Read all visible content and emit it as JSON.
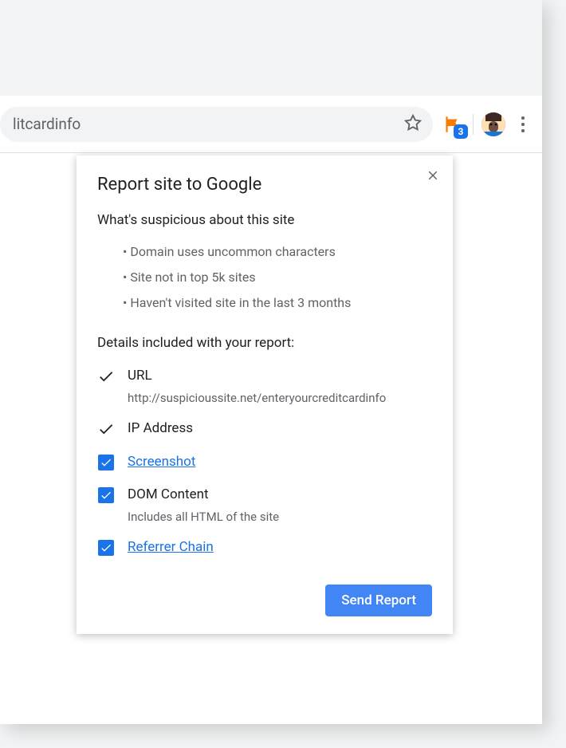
{
  "toolbar": {
    "omnibox_text": "litcardinfo",
    "flag_badge": "3"
  },
  "popup": {
    "title": "Report site to Google",
    "suspicious_heading": "What's suspicious about this site",
    "bullets": [
      "• Domain uses uncommon characters",
      "• Site not in top 5k sites",
      "• Haven't visited site in the last 3 months"
    ],
    "details_heading": "Details included with your report:",
    "items": {
      "url": {
        "label": "URL",
        "sub": "http://suspicioussite.net/enteryourcreditcardinfo"
      },
      "ip": {
        "label": "IP Address"
      },
      "screenshot": {
        "label": "Screenshot"
      },
      "dom": {
        "label": "DOM Content",
        "sub": "Includes all HTML of the site"
      },
      "referrer": {
        "label": "Referrer Chain"
      }
    },
    "send_button": "Send Report"
  }
}
